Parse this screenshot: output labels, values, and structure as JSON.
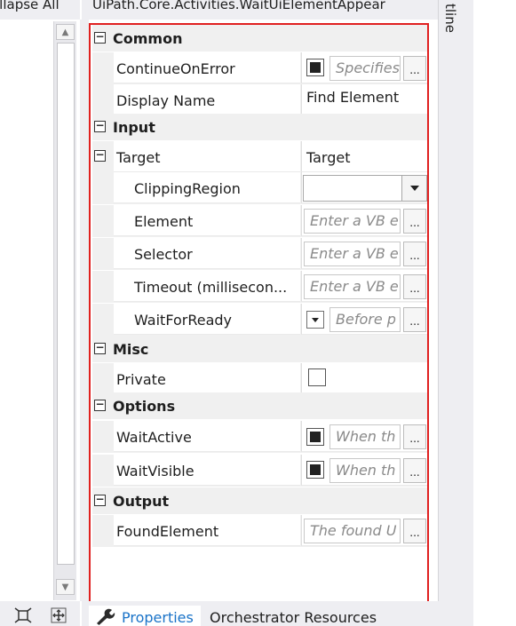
{
  "left_panel": {
    "collapse_label": "ollapse All"
  },
  "header": {
    "title": "UiPath.Core.Activities.WaitUiElementAppear"
  },
  "right_strip": {
    "label": "tline"
  },
  "categories": {
    "common": "Common",
    "input": "Input",
    "misc": "Misc",
    "options": "Options",
    "output": "Output"
  },
  "properties": {
    "continue_on_error": {
      "name": "ContinueOnError",
      "placeholder": "Specifies",
      "checked": true
    },
    "display_name": {
      "name": "Display Name",
      "value": "Find Element"
    },
    "target": {
      "name": "Target",
      "value": "Target"
    },
    "clipping_region": {
      "name": "ClippingRegion",
      "value": ""
    },
    "element": {
      "name": "Element",
      "placeholder": "Enter a VB e"
    },
    "selector": {
      "name": "Selector",
      "placeholder": "Enter a VB e"
    },
    "timeout": {
      "name": "Timeout (millisecon...",
      "placeholder": "Enter a VB e"
    },
    "wait_for_ready": {
      "name": "WaitForReady",
      "placeholder": "Before p"
    },
    "private": {
      "name": "Private",
      "checked": false
    },
    "wait_active": {
      "name": "WaitActive",
      "placeholder": "When th",
      "checked": true
    },
    "wait_visible": {
      "name": "WaitVisible",
      "placeholder": "When th",
      "checked": true
    },
    "found_element": {
      "name": "FoundElement",
      "placeholder": "The found U"
    }
  },
  "buttons": {
    "ellipsis": "..."
  },
  "tabs": {
    "properties": "Properties",
    "orchestrator": "Orchestrator Resources"
  },
  "icons": {
    "tab_properties": "wrench-icon",
    "left_bottom_1": "fit-to-screen-icon",
    "left_bottom_2": "expand-arrows-icon"
  }
}
